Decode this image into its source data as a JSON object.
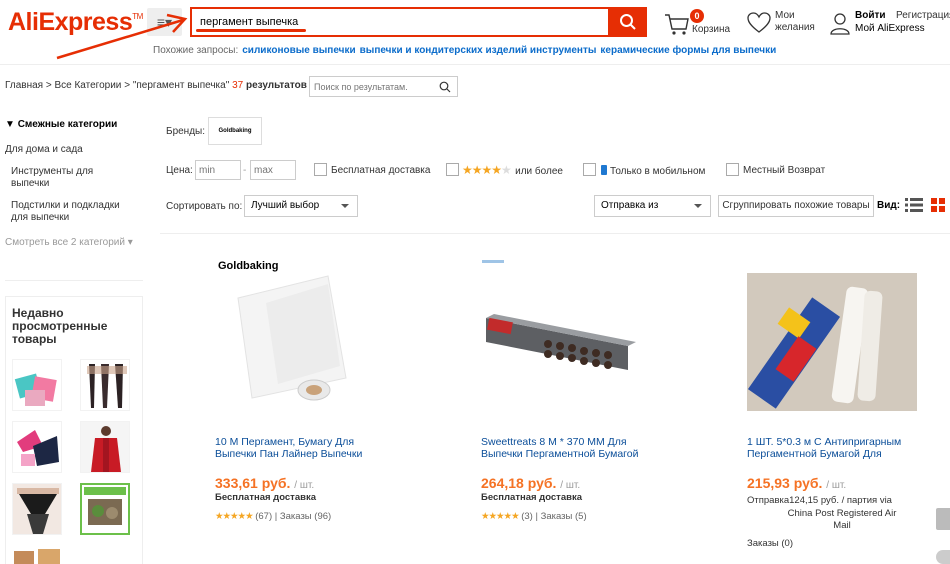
{
  "header": {
    "logo": "AliExpress",
    "logo_tm": "TM",
    "search_value": "пергамент выпечка",
    "cart_count": "0",
    "cart_label": "Корзина",
    "wish_label": "Мои желания",
    "login_label": "Войти",
    "register_label": "Регистрация",
    "my_ali_label": "Мой AliExpress"
  },
  "related": {
    "label": "Похожие запросы:",
    "items": [
      "силиконовые выпечки",
      "выпечки и кондитерских изделий инструменты",
      "керамические формы для выпечки"
    ]
  },
  "breadcrumb": {
    "home": "Главная",
    "sep": ">",
    "all": "Все Категории",
    "query": "\"пергамент выпечка\"",
    "count": "37",
    "results": "результатов",
    "search_placeholder": "Поиск по результатам."
  },
  "sidebar": {
    "title": "Смежные категории",
    "parent": "Для дома и сада",
    "items": [
      "Инструменты для выпечки",
      "Подстилки и подкладки для выпечки"
    ],
    "more": "Смотреть все 2 категорий",
    "recent_title": "Недавно просмотренные товары"
  },
  "filters": {
    "brands_label": "Бренды:",
    "brand": "Goldbaking",
    "price_label": "Цена:",
    "min_placeholder": "min",
    "max_placeholder": "max",
    "free_shipping": "Бесплатная доставка",
    "rating_suffix": "или более",
    "mobile_only": "Только в мобильном",
    "local_return": "Местный Возврат",
    "sort_label": "Сортировать по:",
    "sort_value": "Лучший выбор",
    "ship_from": "Отправка из",
    "group_similar": "Сгруппировать похожие товары",
    "view_label": "Вид:"
  },
  "products": [
    {
      "brand_tag": "Goldbaking",
      "title": "10 М Пергамент, Бумагу Для Выпечки Пан Лайнер Выпечки",
      "price": "333,61 руб.",
      "unit": "/ шт.",
      "shipping": "Бесплатная доставка",
      "stars": "★★★★★",
      "reviews": "(67)",
      "orders": "Заказы (96)"
    },
    {
      "title": "Sweettreats 8 M * 370 MM Для Выпечки Пергаментной Бумагой",
      "price": "264,18 руб.",
      "unit": "/ шт.",
      "shipping": "Бесплатная доставка",
      "stars": "★★★★★",
      "reviews": "(3)",
      "orders": "Заказы (5)"
    },
    {
      "title": "1 ШТ. 5*0.3 м С Антипригарным Пергаментной Бумагой Для",
      "price": "215,93 руб.",
      "unit": "/ шт.",
      "shipping_line1": "Отправка124,15 руб. / партия via",
      "shipping_line2": "China Post Registered Air Mail",
      "orders": "Заказы (0)"
    }
  ],
  "colors": {
    "brand": "#e62e04",
    "price": "#f57224",
    "link": "#0b4e99"
  }
}
